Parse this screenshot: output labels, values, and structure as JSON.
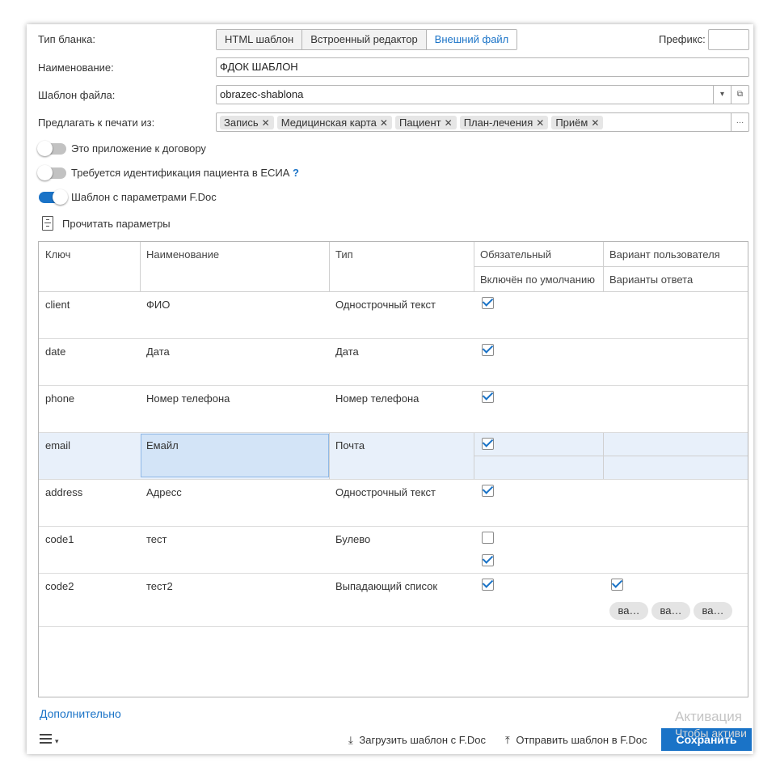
{
  "form": {
    "type_label": "Тип бланка:",
    "type_options": [
      "HTML шаблон",
      "Встроенный редактор",
      "Внешний файл"
    ],
    "prefix_label": "Префикс:",
    "prefix_value": "",
    "name_label": "Наименование:",
    "name_value": "ФДОК ШАБЛОН",
    "file_label": "Шаблон файла:",
    "file_value": "obrazec-shablona",
    "print_label": "Предлагать к печати из:",
    "print_chips": [
      "Запись",
      "Медицинская карта",
      "Пациент",
      "План-лечения",
      "Приём"
    ],
    "toggles": [
      {
        "label": "Это приложение к договору",
        "on": false
      },
      {
        "label": "Требуется идентификация пациента в ЕСИА",
        "on": false
      },
      {
        "label": "Шаблон с параметрами F.Doc",
        "on": true
      }
    ],
    "help_mark": "?",
    "read_params": "Прочитать параметры"
  },
  "table": {
    "headers": {
      "key": "Ключ",
      "name": "Наименование",
      "type": "Тип",
      "required": "Обязательный",
      "default_on": "Включён по умолчанию",
      "user_variant": "Вариант пользователя",
      "answers": "Варианты ответа"
    },
    "rows": [
      {
        "key": "client",
        "name": "ФИО",
        "type": "Однострочный текст",
        "required": true
      },
      {
        "key": "date",
        "name": "Дата",
        "type": "Дата",
        "required": true
      },
      {
        "key": "phone",
        "name": "Номер телефона",
        "type": "Номер телефона",
        "required": true
      },
      {
        "key": "email",
        "name": "Емайл",
        "type": "Почта",
        "required": true
      },
      {
        "key": "address",
        "name": "Адресс",
        "type": "Однострочный текст",
        "required": true
      },
      {
        "key": "code1",
        "name": "тест",
        "type": "Булево",
        "required": false,
        "default_on": true
      },
      {
        "key": "code2",
        "name": "тест2",
        "type": "Выпадающий список",
        "required": true,
        "user_variant": true,
        "answers": [
          "ва…",
          "ва…",
          "ва…"
        ]
      }
    ]
  },
  "footer": {
    "more": "Дополнительно",
    "load": "Загрузить шаблон с F.Doc",
    "send": "Отправить шаблон в F.Doc",
    "save": "Сохранить",
    "watermark1": "Активация",
    "watermark2": "Чтобы активи"
  },
  "colors": {
    "accent": "#1a73c7",
    "selected_row": "#e8f0fa",
    "selected_cell": "#d3e4f7"
  }
}
